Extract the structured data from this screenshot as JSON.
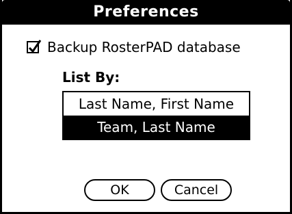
{
  "dialog": {
    "title": "Preferences"
  },
  "backup": {
    "label": "Backup RosterPAD database",
    "checked": true
  },
  "list_by": {
    "label": "List By:",
    "options": [
      {
        "label": "Last Name, First Name",
        "selected": false
      },
      {
        "label": "Team, Last Name",
        "selected": true
      }
    ]
  },
  "buttons": {
    "ok_label": "OK",
    "cancel_label": "Cancel"
  }
}
